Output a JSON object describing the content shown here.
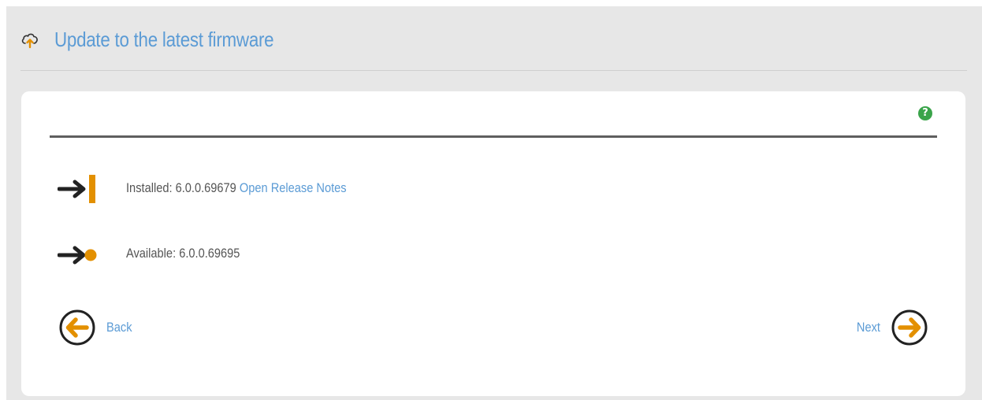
{
  "header": {
    "title": "Update to the latest firmware",
    "icon": "cloud-upload-icon"
  },
  "help": {
    "glyph": "?",
    "icon": "help-icon"
  },
  "firmware": {
    "installed_label": "Installed: 6.0.0.69679",
    "release_notes_link": "Open Release Notes",
    "available_label": "Available: 6.0.0.69695"
  },
  "navigation": {
    "back_label": "Back",
    "next_label": "Next"
  },
  "colors": {
    "accent_orange": "#e39000",
    "link_blue": "#5b9bd5",
    "help_green": "#3aa44a",
    "background_gray": "#e7e7e7"
  }
}
